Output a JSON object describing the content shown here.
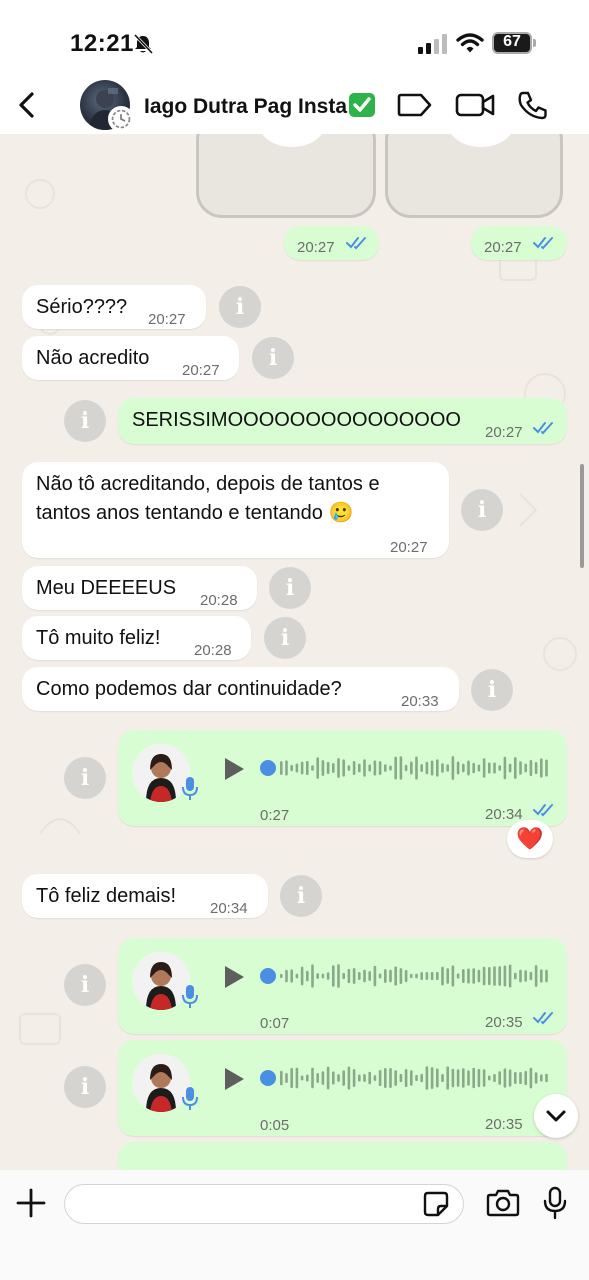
{
  "status_bar": {
    "time": "12:21",
    "battery": "67"
  },
  "header": {
    "contact_name": "Iago Dutra Pag Insta"
  },
  "messages": [
    {
      "dir": "out",
      "time": "20:27"
    },
    {
      "dir": "out",
      "time": "20:27"
    },
    {
      "dir": "in",
      "text": "Sério????",
      "time": "20:27"
    },
    {
      "dir": "in",
      "text": "Não acredito",
      "time": "20:27"
    },
    {
      "dir": "out",
      "text": "SERISSIMOOOOOOOOOOOOOOO",
      "time": "20:27"
    },
    {
      "dir": "in",
      "line1": "Não tô acreditando, depois de tantos e",
      "line2": "tantos anos tentando e tentando 🥲",
      "time": "20:27"
    },
    {
      "dir": "in",
      "text": "Meu DEEEEUS",
      "time": "20:28"
    },
    {
      "dir": "in",
      "text": "Tô muito feliz!",
      "time": "20:28"
    },
    {
      "dir": "in",
      "text": "Como podemos dar continuidade?",
      "time": "20:33"
    },
    {
      "dir": "out",
      "type": "voice",
      "duration": "0:27",
      "time": "20:34",
      "reaction": "❤️"
    },
    {
      "dir": "in",
      "text": "Tô feliz demais!",
      "time": "20:34"
    },
    {
      "dir": "out",
      "type": "voice",
      "duration": "0:07",
      "time": "20:35"
    },
    {
      "dir": "out",
      "type": "voice",
      "duration": "0:05",
      "time": "20:35"
    }
  ],
  "input": {
    "placeholder": ""
  },
  "colors": {
    "outgoing_bubble": "#d9fdd3",
    "incoming_bubble": "#ffffff",
    "read_ticks": "#4a90e2",
    "background": "#f3efe8"
  }
}
